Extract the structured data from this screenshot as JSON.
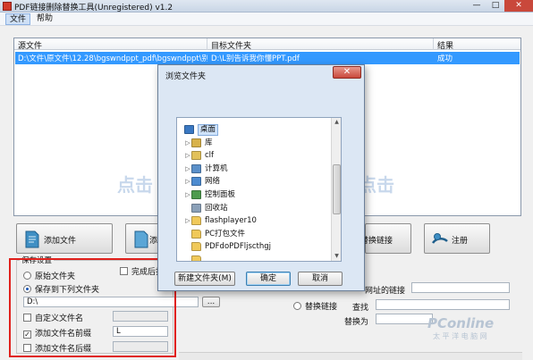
{
  "window": {
    "title": "PDF链接删除替换工具(Unregistered) v1.2",
    "min_glyph": "—",
    "max_glyph": "□",
    "close_glyph": "✕"
  },
  "menu": {
    "file": "文件",
    "help": "帮助"
  },
  "table": {
    "headers": [
      "源文件",
      "目标文件夹",
      "结果"
    ],
    "rows": [
      {
        "source": "D:\\文件\\原文件\\12.28\\bgswndppt_pdf\\bgswndppt\\别告诉...",
        "target": "D:\\L别告诉我你懂PPT.pdf",
        "result": "成功"
      }
    ]
  },
  "watermarks": [
    "点击",
    "点击"
  ],
  "buttons": {
    "add_file": "添加文件",
    "add_folder_partial": "添",
    "replace_link_partial": "替换链接",
    "register": "注册"
  },
  "save_settings": {
    "group_label": "保存设置",
    "original_folder": "原始文件夹",
    "save_to_folder": "保存到下列文件夹",
    "folder_path": "D:\\",
    "browse": "...",
    "complete_open_partial": "完成后打",
    "custom_name": "自定义文件名",
    "add_prefix": "添加文件名前缀",
    "prefix_value": "L",
    "add_suffix": "添加文件名后缀",
    "check_mark": "✓"
  },
  "right_form": {
    "url_link_partial": "网址的链接",
    "replace_link": "替换链接",
    "find": "查找",
    "replace_with": "替换为"
  },
  "dialog": {
    "title": "浏览文件夹",
    "close_glyph": "✕",
    "tree": [
      {
        "label": "桌面",
        "icon": "desktop-icon",
        "expand": "",
        "selected": true
      },
      {
        "label": "库",
        "icon": "library-icon",
        "expand": "▷"
      },
      {
        "label": "clf",
        "icon": "user-folder-icon",
        "expand": "▷"
      },
      {
        "label": "计算机",
        "icon": "computer-icon",
        "expand": "▷"
      },
      {
        "label": "网络",
        "icon": "network-icon",
        "expand": "▷"
      },
      {
        "label": "控制面板",
        "icon": "control-panel-icon",
        "expand": "▷"
      },
      {
        "label": "回收站",
        "icon": "recycle-bin-icon",
        "expand": ""
      },
      {
        "label": "flashplayer10",
        "icon": "folder-icon",
        "expand": "▷"
      },
      {
        "label": "PC打包文件",
        "icon": "folder-icon",
        "expand": ""
      },
      {
        "label": "PDFdoPDFljscthgj",
        "icon": "folder-icon",
        "expand": ""
      },
      {
        "label": "",
        "icon": "folder-icon",
        "expand": ""
      }
    ],
    "new_folder": "新建文件夹(M)",
    "ok": "确定",
    "cancel": "取消"
  },
  "branding": {
    "logo": "PConline",
    "subtitle": "太 平 洋 电 脑 网"
  },
  "colors": {
    "selection": "#3399ff",
    "highlight_box": "#e0201c"
  }
}
